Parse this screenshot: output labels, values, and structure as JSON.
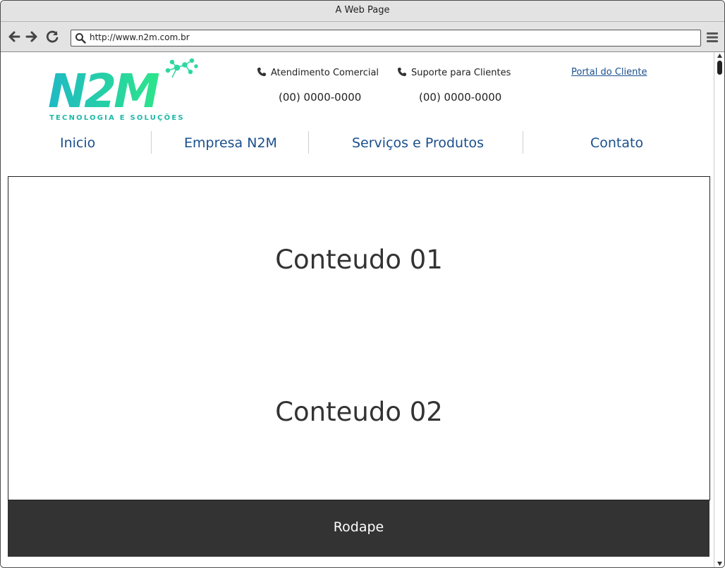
{
  "window": {
    "title": "A Web Page"
  },
  "browser": {
    "url": "http://www.n2m.com.br",
    "back_icon": "arrow-left-icon",
    "forward_icon": "arrow-right-icon",
    "reload_icon": "reload-icon",
    "menu_icon": "hamburger-icon"
  },
  "logo": {
    "text": "N2M",
    "tagline": "TECNOLOGIA E SOLUÇÕES"
  },
  "header": {
    "commercial": {
      "label": "Atendimento Comercial",
      "phone": "(00) 0000-0000"
    },
    "support": {
      "label": "Suporte para Clientes",
      "phone": "(00) 0000-0000"
    },
    "portal_link": "Portal do Cliente"
  },
  "nav": [
    {
      "label": "Inicio"
    },
    {
      "label": "Empresa N2M"
    },
    {
      "label": "Serviços e Produtos"
    },
    {
      "label": "Contato"
    }
  ],
  "content": [
    {
      "title": "Conteudo 01"
    },
    {
      "title": "Conteudo 02"
    }
  ],
  "footer": {
    "text": "Rodape"
  },
  "colors": {
    "nav_text": "#1a4f8c",
    "footer_bg": "#333333",
    "logo_gradient_start": "#1fb9c4",
    "logo_gradient_end": "#2de58a"
  }
}
